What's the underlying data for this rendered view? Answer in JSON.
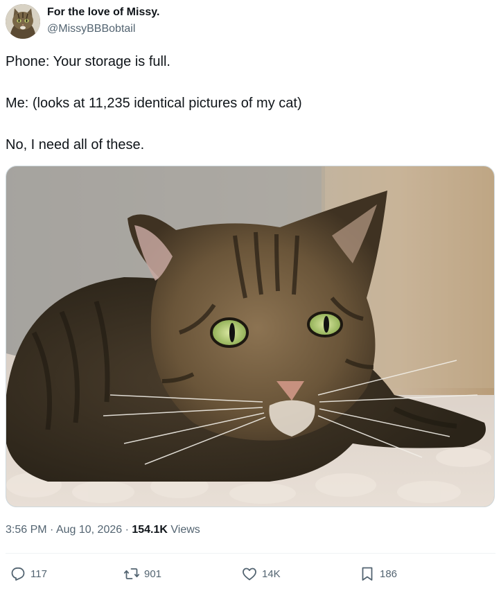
{
  "author": {
    "display_name": "For the love of Missy.",
    "handle": "@MissyBBBobtail"
  },
  "tweet": {
    "lines": [
      "Phone: Your storage is full.",
      "Me: (looks at 11,235 identical pictures of my cat)",
      "No, I need all of these."
    ]
  },
  "meta": {
    "time": "3:56 PM",
    "separator": " · ",
    "date": "Aug 10, 2026",
    "views_count": "154.1K",
    "views_label": "Views"
  },
  "actions": {
    "replies": "117",
    "reposts": "901",
    "likes": "14K",
    "bookmarks": "186"
  },
  "icons": {
    "reply": "reply-icon",
    "repost": "repost-icon",
    "like": "heart-icon",
    "bookmark": "bookmark-icon"
  },
  "colors": {
    "text_primary": "#0f1419",
    "text_secondary": "#536471",
    "border": "#cfd9de"
  }
}
